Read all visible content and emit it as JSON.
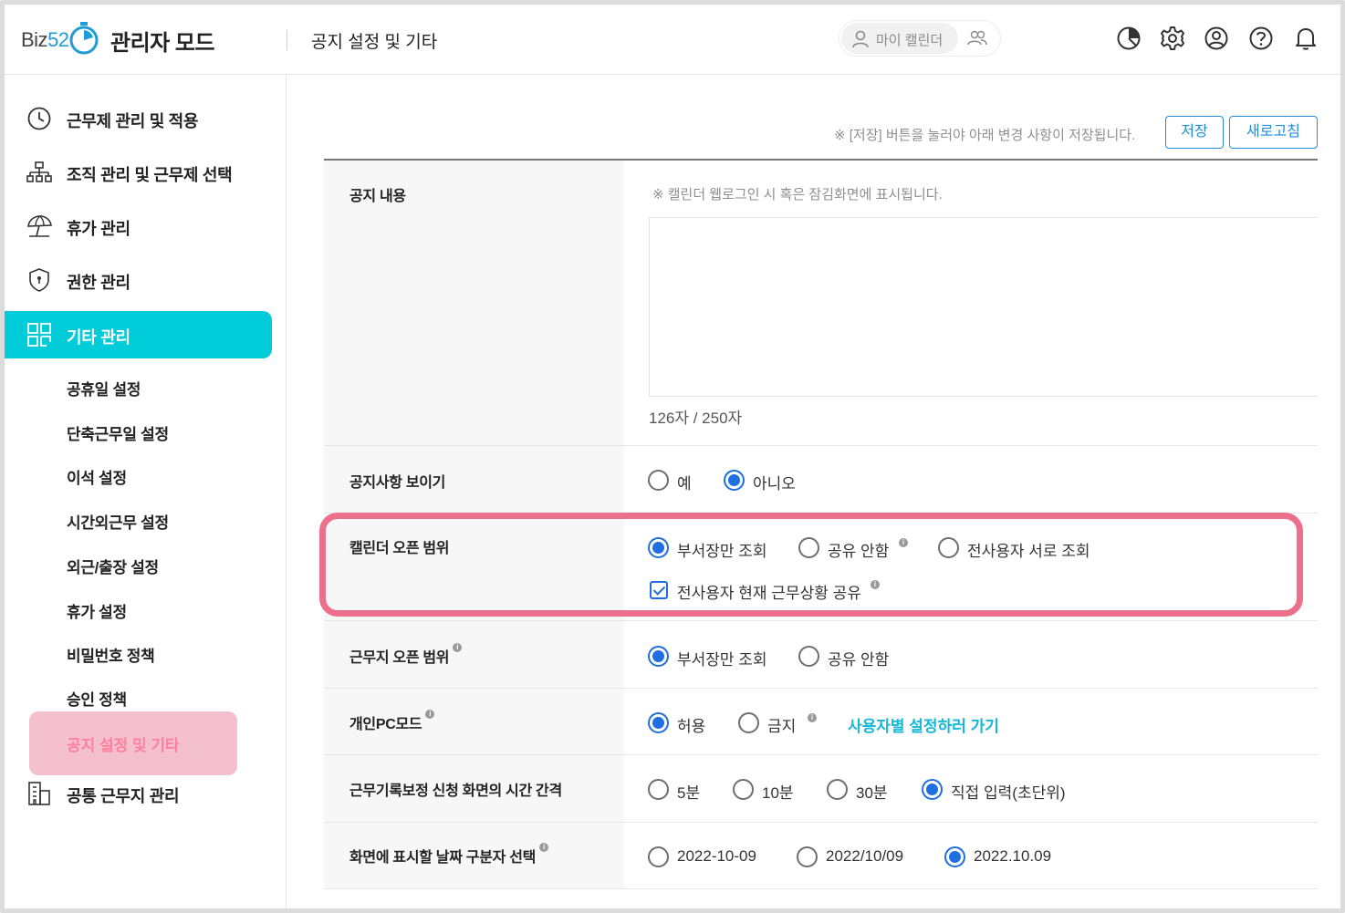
{
  "header": {
    "logo_text_biz": "Biz",
    "logo_text_num": "52",
    "app_title": "관리자 모드",
    "page_title": "공지 설정 및 기타",
    "my_calendar": "마이 캘린더",
    "icons": [
      "chart-pie-icon",
      "gear-icon",
      "user-circle-icon",
      "help-icon",
      "bell-icon"
    ]
  },
  "sidebar": {
    "items": [
      {
        "label": "근무제 관리 및 적용",
        "icon": "clock-icon"
      },
      {
        "label": "조직 관리 및 근무제 선택",
        "icon": "org-chart-icon"
      },
      {
        "label": "휴가 관리",
        "icon": "umbrella-icon"
      },
      {
        "label": "권한 관리",
        "icon": "shield-icon"
      },
      {
        "label": "기타 관리",
        "icon": "grid-icon"
      }
    ],
    "sub_items": [
      "공휴일 설정",
      "단축근무일 설정",
      "이석 설정",
      "시간외근무 설정",
      "외근/출장 설정",
      "휴가 설정",
      "비밀번호 정책",
      "승인 정책",
      "공지 설정 및 기타"
    ],
    "last_item": {
      "label": "공통 근무지 관리",
      "icon": "building-icon"
    }
  },
  "main": {
    "save_notice": "※ [저장] 버튼을 눌러야 아래 변경 사항이 저장됩니다.",
    "save_button": "저장",
    "refresh_button": "새로고침",
    "notice_content": {
      "label": "공지 내용",
      "hint": "※ 캘린더 웹로그인 시 혹은 잠김화면에 표시됩니다.",
      "counter": "126자 / 250자"
    },
    "show_notice": {
      "label": "공지사항 보이기",
      "options": [
        "예",
        "아니오"
      ]
    },
    "calendar_scope": {
      "label": "캘린더 오픈 범위",
      "options": [
        "부서장만 조회",
        "공유 안함",
        "전사용자 서로 조회"
      ],
      "checkbox": "전사용자 현재 근무상황 공유"
    },
    "workplace_scope": {
      "label": "근무지 오픈 범위",
      "options": [
        "부서장만 조회",
        "공유 안함"
      ]
    },
    "pc_mode": {
      "label": "개인PC모드",
      "options": [
        "허용",
        "금지"
      ],
      "link": "사용자별 설정하러 가기"
    },
    "time_interval": {
      "label": "근무기록보정 신청 화면의 시간 간격",
      "options": [
        "5분",
        "10분",
        "30분",
        "직접 입력(초단위)"
      ]
    },
    "date_separator": {
      "label": "화면에 표시할 날짜 구분자 선택",
      "options": [
        "2022-10-09",
        "2022/10/09",
        "2022.10.09"
      ]
    }
  },
  "colors": {
    "accent": "#00cbd8",
    "primary": "#1f6fe0",
    "button": "#1f8fd9",
    "highlight": "#ec6f8c",
    "sub_active_bg": "#f5c0ce",
    "sub_active_text": "#ff7f9f",
    "link": "#14b8d8"
  }
}
